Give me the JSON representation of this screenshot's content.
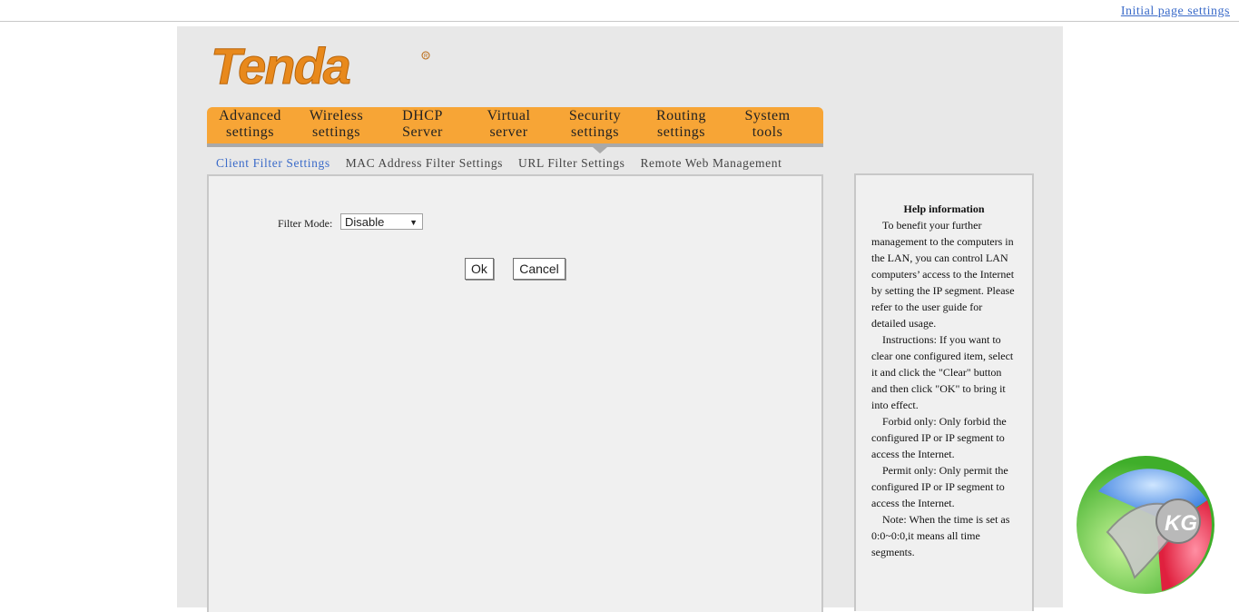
{
  "header": {
    "initial_link": "Initial page settings"
  },
  "brand": {
    "logo_text": "Tenda",
    "accent_color": "#f7a536",
    "logo_color": "#e8891c"
  },
  "main_nav": {
    "tabs": [
      {
        "line1": "Advanced",
        "line2": "settings"
      },
      {
        "line1": "Wireless",
        "line2": "settings"
      },
      {
        "line1": "DHCP",
        "line2": "Server"
      },
      {
        "line1": "Virtual",
        "line2": "server"
      },
      {
        "line1": "Security",
        "line2": "settings",
        "active": true
      },
      {
        "line1": "Routing",
        "line2": "settings"
      },
      {
        "line1": "System",
        "line2": "tools"
      }
    ]
  },
  "sub_nav": {
    "items": [
      {
        "label": "Client Filter Settings",
        "active": true
      },
      {
        "label": "MAC Address Filter Settings"
      },
      {
        "label": "URL Filter Settings"
      },
      {
        "label": "Remote Web Management"
      }
    ]
  },
  "form": {
    "filter_mode_label": "Filter Mode:",
    "filter_mode_value": "Disable",
    "ok_label": "Ok",
    "cancel_label": "Cancel"
  },
  "help": {
    "title": "Help information",
    "paragraphs": [
      "To benefit your further management to the computers in the LAN, you can control LAN computers’ access to the Internet by setting the IP segment. Please refer to the user guide for detailed usage.",
      "Instructions: If you want to clear one configured item, select it and click the \"Clear\" button and then click \"OK\" to bring it into effect.",
      "Forbid only: Only forbid the configured IP or IP segment to access the Internet.",
      "Permit only: Only permit the configured IP or IP segment to access the Internet.",
      "Note: When the time is set as 0:0~0:0,it means all time segments."
    ]
  },
  "watermark": {
    "text": "KG"
  }
}
